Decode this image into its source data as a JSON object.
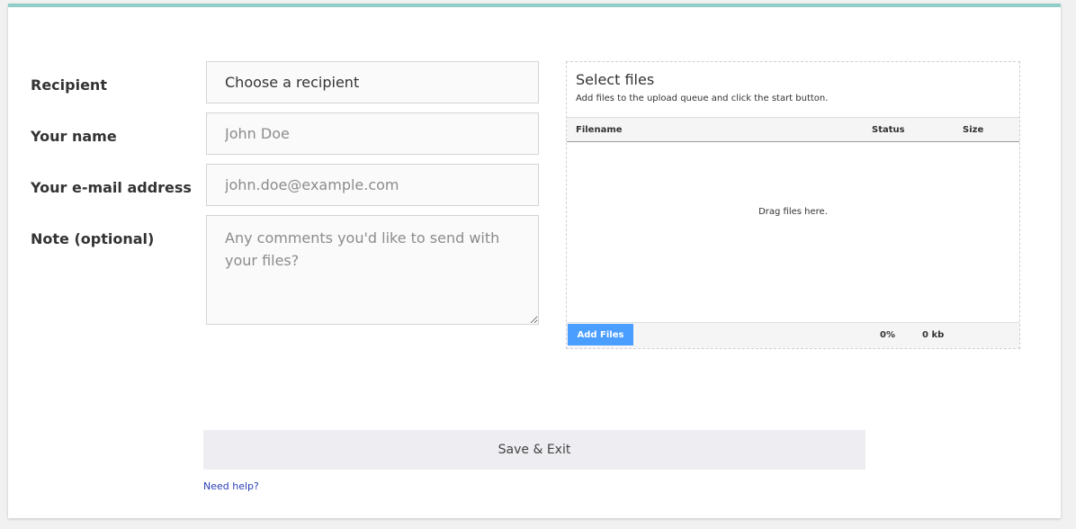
{
  "form": {
    "recipient": {
      "label": "Recipient",
      "value": "Choose a recipient"
    },
    "name": {
      "label": "Your name",
      "placeholder": "John Doe",
      "value": ""
    },
    "email": {
      "label": "Your e-mail address",
      "placeholder": "john.doe@example.com",
      "value": ""
    },
    "note": {
      "label": "Note (optional)",
      "placeholder": "Any comments you'd like to send with your files?",
      "value": ""
    }
  },
  "uploader": {
    "title": "Select files",
    "subtitle": "Add files to the upload queue and click the start button.",
    "columns": {
      "filename": "Filename",
      "status": "Status",
      "size": "Size"
    },
    "drop_text": "Drag files here.",
    "add_button": "Add Files",
    "progress_percent": "0%",
    "total_size": "0 kb",
    "files": []
  },
  "actions": {
    "save_label": "Save & Exit",
    "help_link": "Need help?"
  },
  "colors": {
    "top_border": "#8fcfc8",
    "add_button": "#4a9eff",
    "link": "#2a3fb5"
  }
}
